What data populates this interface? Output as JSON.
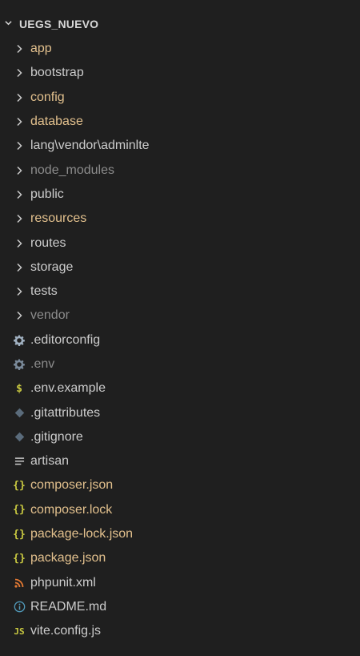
{
  "explorer": {
    "project_name": "UEGS_NUEVO",
    "folders": [
      {
        "name": "app",
        "color": "#e2c08d",
        "icon": "chevron-right-icon"
      },
      {
        "name": "bootstrap",
        "color": "#cccccc",
        "icon": "chevron-right-icon"
      },
      {
        "name": "config",
        "color": "#e2c08d",
        "icon": "chevron-right-icon"
      },
      {
        "name": "database",
        "color": "#e2c08d",
        "icon": "chevron-right-icon"
      },
      {
        "name": "lang\\vendor\\adminlte",
        "color": "#cccccc",
        "icon": "chevron-right-icon"
      },
      {
        "name": "node_modules",
        "color": "#8c8c8c",
        "icon": "chevron-right-icon"
      },
      {
        "name": "public",
        "color": "#cccccc",
        "icon": "chevron-right-icon"
      },
      {
        "name": "resources",
        "color": "#e2c08d",
        "icon": "chevron-right-icon"
      },
      {
        "name": "routes",
        "color": "#cccccc",
        "icon": "chevron-right-icon"
      },
      {
        "name": "storage",
        "color": "#cccccc",
        "icon": "chevron-right-icon"
      },
      {
        "name": "tests",
        "color": "#cccccc",
        "icon": "chevron-right-icon"
      },
      {
        "name": "vendor",
        "color": "#8c8c8c",
        "icon": "chevron-right-icon"
      }
    ],
    "files": [
      {
        "name": ".editorconfig",
        "color": "#cccccc",
        "icon": "gear-icon",
        "icon_color": "#a0b0c0"
      },
      {
        "name": ".env",
        "color": "#8c8c8c",
        "icon": "gear-icon",
        "icon_color": "#7a8a9a"
      },
      {
        "name": ".env.example",
        "color": "#cccccc",
        "icon": "dollar-icon",
        "icon_color": "#cbcb41",
        "glyph": "$"
      },
      {
        "name": ".gitattributes",
        "color": "#cccccc",
        "icon": "git-diamond-icon",
        "icon_color": "#5a6b7b"
      },
      {
        "name": ".gitignore",
        "color": "#cccccc",
        "icon": "git-diamond-icon",
        "icon_color": "#5a6b7b"
      },
      {
        "name": "artisan",
        "color": "#cccccc",
        "icon": "lines-icon",
        "icon_color": "#cccccc"
      },
      {
        "name": "composer.json",
        "color": "#e2c08d",
        "icon": "braces-icon",
        "icon_color": "#cbcb41",
        "glyph": "{}"
      },
      {
        "name": "composer.lock",
        "color": "#e2c08d",
        "icon": "braces-icon",
        "icon_color": "#cbcb41",
        "glyph": "{}"
      },
      {
        "name": "package-lock.json",
        "color": "#e2c08d",
        "icon": "braces-icon",
        "icon_color": "#cbcb41",
        "glyph": "{}"
      },
      {
        "name": "package.json",
        "color": "#e2c08d",
        "icon": "braces-icon",
        "icon_color": "#cbcb41",
        "glyph": "{}"
      },
      {
        "name": "phpunit.xml",
        "color": "#cccccc",
        "icon": "rss-icon",
        "icon_color": "#e37933"
      },
      {
        "name": "README.md",
        "color": "#cccccc",
        "icon": "info-icon",
        "icon_color": "#519aba"
      },
      {
        "name": "vite.config.js",
        "color": "#cccccc",
        "icon": "js-icon",
        "icon_color": "#cbcb41",
        "glyph": "JS"
      }
    ]
  }
}
